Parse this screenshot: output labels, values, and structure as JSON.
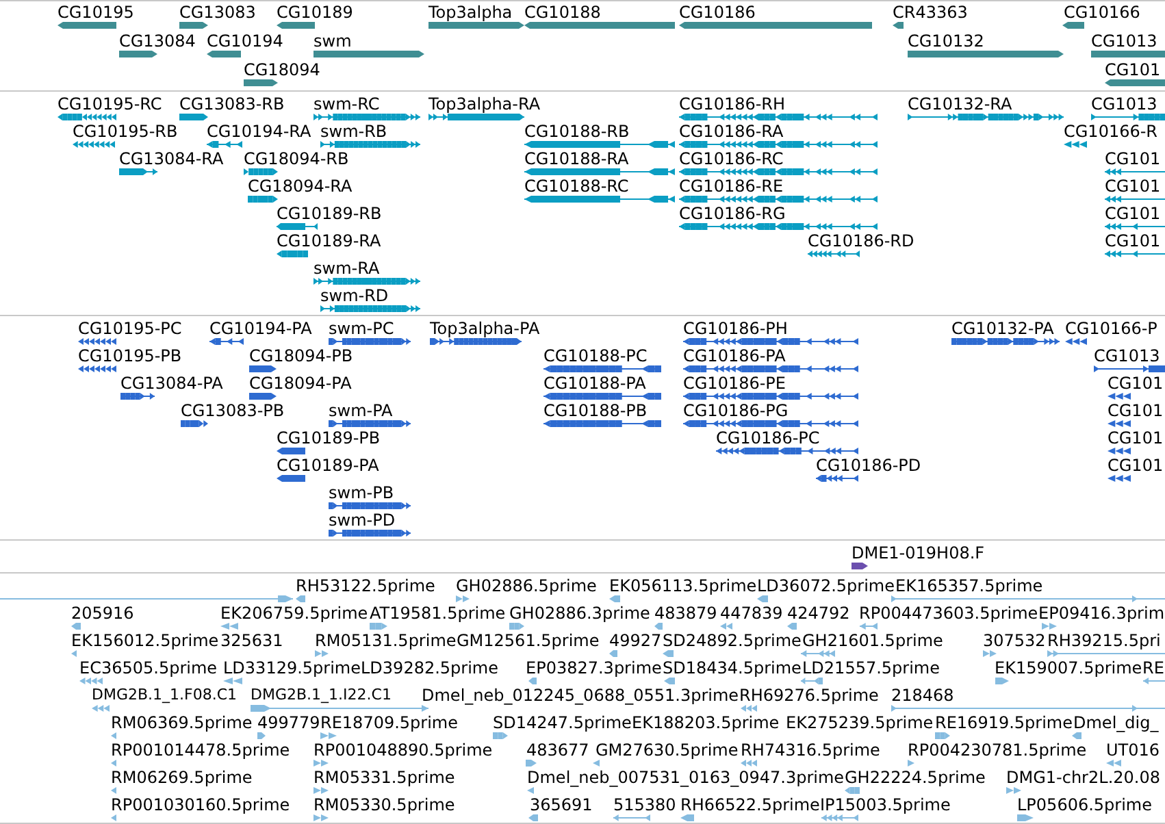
{
  "tracks": [
    {
      "color": "#3f8e93",
      "features": [
        {
          "label": "CG10195",
          "forward": false
        },
        {
          "label": "CG13083",
          "forward": true
        },
        {
          "label": "CG10189",
          "forward": false
        },
        {
          "label": "Top3alpha",
          "forward": true
        },
        {
          "label": "CG10188",
          "forward": false
        },
        {
          "label": "CG10186",
          "forward": false
        },
        {
          "label": "CR43363",
          "forward": false
        },
        {
          "label": "CG10166",
          "forward": false
        },
        {
          "label": "CG13084",
          "forward": true
        },
        {
          "label": "CG10194",
          "forward": false
        },
        {
          "label": "swm",
          "forward": true
        },
        {
          "label": "CG10132",
          "forward": true
        },
        {
          "label": "CG1013"
        },
        {
          "label": "CG18094",
          "forward": true
        },
        {
          "label": "CG101",
          "forward": false
        }
      ]
    },
    {
      "color": "#0b9ec3",
      "features": [
        {
          "label": "CG10195-RC",
          "forward": false
        },
        {
          "label": "CG13083-RB",
          "forward": true
        },
        {
          "label": "swm-RC",
          "forward": true
        },
        {
          "label": "Top3alpha-RA",
          "forward": true
        },
        {
          "label": "CG10186-RH",
          "forward": false
        },
        {
          "label": "CG10132-RA",
          "forward": true
        },
        {
          "label": "CG1013",
          "forward": true
        },
        {
          "label": "CG10195-RB",
          "forward": false
        },
        {
          "label": "CG10194-RA",
          "forward": false
        },
        {
          "label": "swm-RB",
          "forward": true
        },
        {
          "label": "CG10188-RB",
          "forward": false
        },
        {
          "label": "CG10186-RA",
          "forward": false
        },
        {
          "label": "CG10166-R",
          "forward": false
        },
        {
          "label": "CG13084-RA",
          "forward": true
        },
        {
          "label": "CG18094-RB",
          "forward": true
        },
        {
          "label": "CG10188-RA",
          "forward": false
        },
        {
          "label": "CG10186-RC",
          "forward": false
        },
        {
          "label": "CG101",
          "forward": false
        },
        {
          "label": "CG18094-RA",
          "forward": true
        },
        {
          "label": "CG10188-RC",
          "forward": false
        },
        {
          "label": "CG10186-RE",
          "forward": false
        },
        {
          "label": "CG101",
          "forward": false
        },
        {
          "label": "CG10189-RB",
          "forward": false
        },
        {
          "label": "CG10186-RG",
          "forward": false
        },
        {
          "label": "CG101",
          "forward": false
        },
        {
          "label": "CG10189-RA",
          "forward": false
        },
        {
          "label": "CG10186-RD",
          "forward": false
        },
        {
          "label": "CG101",
          "forward": false
        },
        {
          "label": "swm-RA",
          "forward": true
        },
        {
          "label": "swm-RD",
          "forward": true
        }
      ]
    },
    {
      "color": "#2e6bd1",
      "features": [
        {
          "label": "CG10195-PC",
          "forward": false
        },
        {
          "label": "CG10194-PA",
          "forward": false
        },
        {
          "label": "swm-PC",
          "forward": true
        },
        {
          "label": "Top3alpha-PA",
          "forward": true
        },
        {
          "label": "CG10186-PH",
          "forward": false
        },
        {
          "label": "CG10132-PA",
          "forward": true
        },
        {
          "label": "CG10166-P",
          "forward": false
        },
        {
          "label": "CG10195-PB",
          "forward": false
        },
        {
          "label": "CG18094-PB",
          "forward": true
        },
        {
          "label": "CG10188-PC",
          "forward": false
        },
        {
          "label": "CG10186-PA",
          "forward": false
        },
        {
          "label": "CG1013",
          "forward": true
        },
        {
          "label": "CG13084-PA",
          "forward": true
        },
        {
          "label": "CG18094-PA",
          "forward": true
        },
        {
          "label": "CG10188-PA",
          "forward": false
        },
        {
          "label": "CG10186-PE",
          "forward": false
        },
        {
          "label": "CG101",
          "forward": false
        },
        {
          "label": "CG13083-PB",
          "forward": true
        },
        {
          "label": "swm-PA",
          "forward": true
        },
        {
          "label": "CG10188-PB",
          "forward": false
        },
        {
          "label": "CG10186-PG",
          "forward": false
        },
        {
          "label": "CG101",
          "forward": false
        },
        {
          "label": "CG10189-PB",
          "forward": false
        },
        {
          "label": "CG10186-PC",
          "forward": false
        },
        {
          "label": "CG101",
          "forward": false
        },
        {
          "label": "CG10189-PA",
          "forward": false
        },
        {
          "label": "CG10186-PD",
          "forward": false
        },
        {
          "label": "CG101",
          "forward": false
        },
        {
          "label": "swm-PB",
          "forward": true
        },
        {
          "label": "swm-PD",
          "forward": true
        }
      ]
    },
    {
      "color": "#6b4fae",
      "features": [
        {
          "label": "DME1-019H08.F",
          "forward": true
        }
      ]
    },
    {
      "color": "#86bce0",
      "features": [
        {
          "forward": true
        },
        {
          "label": "RH53122.5prime",
          "forward": false
        },
        {
          "label": "GH02886.5prime",
          "forward": true
        },
        {
          "label": "EK056113.5prime",
          "forward": false
        },
        {
          "label": "LD36072.5prime",
          "forward": false
        },
        {
          "label": "EK165357.5prime",
          "forward": true
        },
        {
          "label": "205916",
          "forward": false
        },
        {
          "label": "EK206759.5prime",
          "forward": false
        },
        {
          "label": "AT19581.5prime",
          "forward": true
        },
        {
          "label": "GH02886.3prime",
          "forward": true
        },
        {
          "label": "483879",
          "forward": false
        },
        {
          "label": "447839",
          "forward": false
        },
        {
          "label": "424792",
          "forward": false
        },
        {
          "label": "RP004473603.5prime",
          "forward": false
        },
        {
          "label": "EP09416.3prim",
          "forward": true
        },
        {
          "label": "EK156012.5prime",
          "forward": false
        },
        {
          "label": "325631"
        },
        {
          "label": "RM05131.5prime",
          "forward": true
        },
        {
          "label": "GM12561.5prime"
        },
        {
          "label": "49927",
          "forward": false
        },
        {
          "label": "SD24892.5prime",
          "forward": false
        },
        {
          "label": "GH21601.5prime",
          "forward": false
        },
        {
          "label": "307532",
          "forward": true
        },
        {
          "label": "RH39215.5pri",
          "forward": true
        },
        {
          "label": "EC36505.5prime",
          "forward": false
        },
        {
          "label": "LD33129.5prime",
          "forward": false
        },
        {
          "label": "LD39282.5prime"
        },
        {
          "label": "EP03827.3prime",
          "forward": false
        },
        {
          "label": "SD18434.5prime",
          "forward": false
        },
        {
          "label": "LD21557.5prime",
          "forward": false
        },
        {
          "label": "EK159007.5prime",
          "forward": true
        },
        {
          "label": "RE",
          "forward": false
        },
        {
          "label": "DMG2B.1_1.F08.C1",
          "forward": false
        },
        {
          "label": "DMG2B.1_1.I22.C1",
          "forward": true
        },
        {
          "label": "Dmel_neb_012245_0688_0551.3prime"
        },
        {
          "label": "RH69276.5prime",
          "forward": false
        },
        {
          "label": "218468",
          "forward": true
        },
        {
          "label": "RM06369.5prime",
          "forward": false
        },
        {
          "label": "499779",
          "forward": true
        },
        {
          "label": "RE18709.5prime",
          "forward": true
        },
        {
          "label": "SD14247.5prime",
          "forward": true
        },
        {
          "label": "EK188203.5prime"
        },
        {
          "label": "EK275239.5prime"
        },
        {
          "label": "RE16919.5prime",
          "forward": true
        },
        {
          "label": "Dmel_dig_",
          "forward": false
        },
        {
          "label": "RP001014478.5prime",
          "forward": false
        },
        {
          "label": "RP001048890.5prime",
          "forward": true
        },
        {
          "label": "483677",
          "forward": true
        },
        {
          "label": "GM27630.5prime",
          "forward": false
        },
        {
          "label": "RH74316.5prime",
          "forward": false
        },
        {
          "label": "RP004230781.5prime",
          "forward": true
        },
        {
          "label": "UT016",
          "forward": false
        },
        {
          "label": "RM06269.5prime",
          "forward": false
        },
        {
          "label": "RM05331.5prime",
          "forward": true
        },
        {
          "label": "Dmel_neb_007531_0163_0947.3prime",
          "forward": false
        },
        {
          "label": "GH22224.5prime",
          "forward": false
        },
        {
          "label": "DMG1-chr2L.20.08",
          "forward": true
        },
        {
          "label": "RP001030160.5prime",
          "forward": false
        },
        {
          "label": "RM05330.5prime",
          "forward": true
        },
        {
          "label": "365691",
          "forward": false
        },
        {
          "label": "515380",
          "forward": false
        },
        {
          "label": "RH66522.5prime",
          "forward": false
        },
        {
          "label": "IP15003.5prime",
          "forward": false
        },
        {
          "label": "LP05606.5prime",
          "forward": true
        }
      ]
    }
  ]
}
